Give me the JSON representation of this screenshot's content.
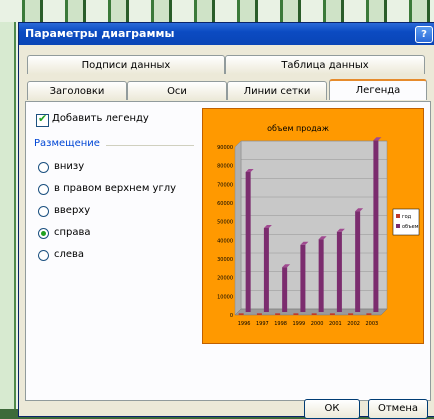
{
  "dialog": {
    "title": "Параметры диаграммы",
    "help": "?",
    "tabs_row1": [
      "Подписи данных",
      "Таблица данных"
    ],
    "tabs_row2": [
      "Заголовки",
      "Оси",
      "Линии сетки",
      "Легенда"
    ],
    "active_tab": "Легенда",
    "add_legend_label": "Добавить легенду",
    "add_legend_checked": true,
    "placement_title": "Размещение",
    "placement_options": [
      "внизу",
      "в правом верхнем углу",
      "вверху",
      "справа",
      "слева"
    ],
    "placement_selected": "справа",
    "ok_label": "ОК",
    "cancel_label": "Отмена"
  },
  "chart_data": {
    "type": "bar",
    "title": "объем продаж",
    "categories": [
      "1996",
      "1997",
      "1998",
      "1999",
      "2000",
      "2001",
      "2002",
      "2003"
    ],
    "series": [
      {
        "name": "год",
        "values": [
          0.6,
          0.6,
          0.6,
          0.6,
          0.6,
          0.6,
          0.6,
          0.6
        ],
        "color": "#c0392b"
      },
      {
        "name": "объем",
        "values": [
          75000,
          45000,
          24000,
          36000,
          39000,
          43000,
          54000,
          92000
        ],
        "color": "#7b2c6e"
      }
    ],
    "yticks": [
      "90000",
      "80000",
      "70000",
      "60000",
      "50000",
      "40000",
      "30000",
      "20000",
      "10000",
      "0"
    ],
    "ylim": [
      0,
      90000
    ],
    "legend_position": "right"
  },
  "colors": {
    "chart_bg": "#ff9900",
    "plot_wall": "#c8c8c8",
    "accent": "#e68b2c"
  }
}
